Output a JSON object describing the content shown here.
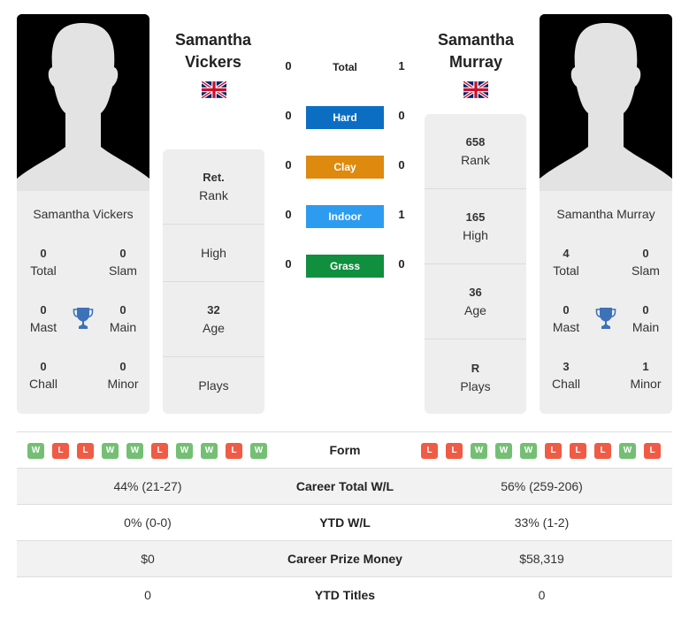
{
  "colors": {
    "hard": "#0c6ec3",
    "clay": "#dd8a0e",
    "indoor": "#2d9cf0",
    "grass": "#108f3e",
    "win": "#74bf74",
    "loss": "#ef5b45",
    "trophy": "#3d72b8"
  },
  "player1": {
    "name_line1": "Samantha",
    "name_line2": "Vickers",
    "full_name": "Samantha Vickers",
    "flag": "uk-flag",
    "titles": {
      "total": "0",
      "total_label": "Total",
      "slam": "0",
      "slam_label": "Slam",
      "mast": "0",
      "mast_label": "Mast",
      "main": "0",
      "main_label": "Main",
      "chall": "0",
      "chall_label": "Chall",
      "minor": "0",
      "minor_label": "Minor"
    },
    "info": {
      "rank_value": "Ret.",
      "rank_label": "Rank",
      "high_value": "",
      "high_label": "High",
      "age_value": "32",
      "age_label": "Age",
      "plays_value": "",
      "plays_label": "Plays"
    },
    "form": [
      "W",
      "L",
      "L",
      "W",
      "W",
      "L",
      "W",
      "W",
      "L",
      "W"
    ],
    "career_wl": "44% (21-27)",
    "ytd_wl": "0% (0-0)",
    "prize_money": "$0",
    "ytd_titles": "0"
  },
  "player2": {
    "name_line1": "Samantha",
    "name_line2": "Murray",
    "full_name": "Samantha Murray",
    "flag": "uk-flag",
    "titles": {
      "total": "4",
      "total_label": "Total",
      "slam": "0",
      "slam_label": "Slam",
      "mast": "0",
      "mast_label": "Mast",
      "main": "0",
      "main_label": "Main",
      "chall": "3",
      "chall_label": "Chall",
      "minor": "1",
      "minor_label": "Minor"
    },
    "info": {
      "rank_value": "658",
      "rank_label": "Rank",
      "high_value": "165",
      "high_label": "High",
      "age_value": "36",
      "age_label": "Age",
      "plays_value": "R",
      "plays_label": "Plays"
    },
    "form": [
      "L",
      "L",
      "W",
      "W",
      "W",
      "L",
      "L",
      "L",
      "W",
      "L"
    ],
    "career_wl": "56% (259-206)",
    "ytd_wl": "33% (1-2)",
    "prize_money": "$58,319",
    "ytd_titles": "0"
  },
  "h2h": {
    "total": {
      "label": "Total",
      "p1": "0",
      "p2": "1"
    },
    "hard": {
      "label": "Hard",
      "p1": "0",
      "p2": "0"
    },
    "clay": {
      "label": "Clay",
      "p1": "0",
      "p2": "0"
    },
    "indoor": {
      "label": "Indoor",
      "p1": "0",
      "p2": "1"
    },
    "grass": {
      "label": "Grass",
      "p1": "0",
      "p2": "0"
    }
  },
  "table": {
    "form_label": "Form",
    "career_wl_label": "Career Total W/L",
    "ytd_wl_label": "YTD W/L",
    "prize_label": "Career Prize Money",
    "ytd_titles_label": "YTD Titles"
  }
}
